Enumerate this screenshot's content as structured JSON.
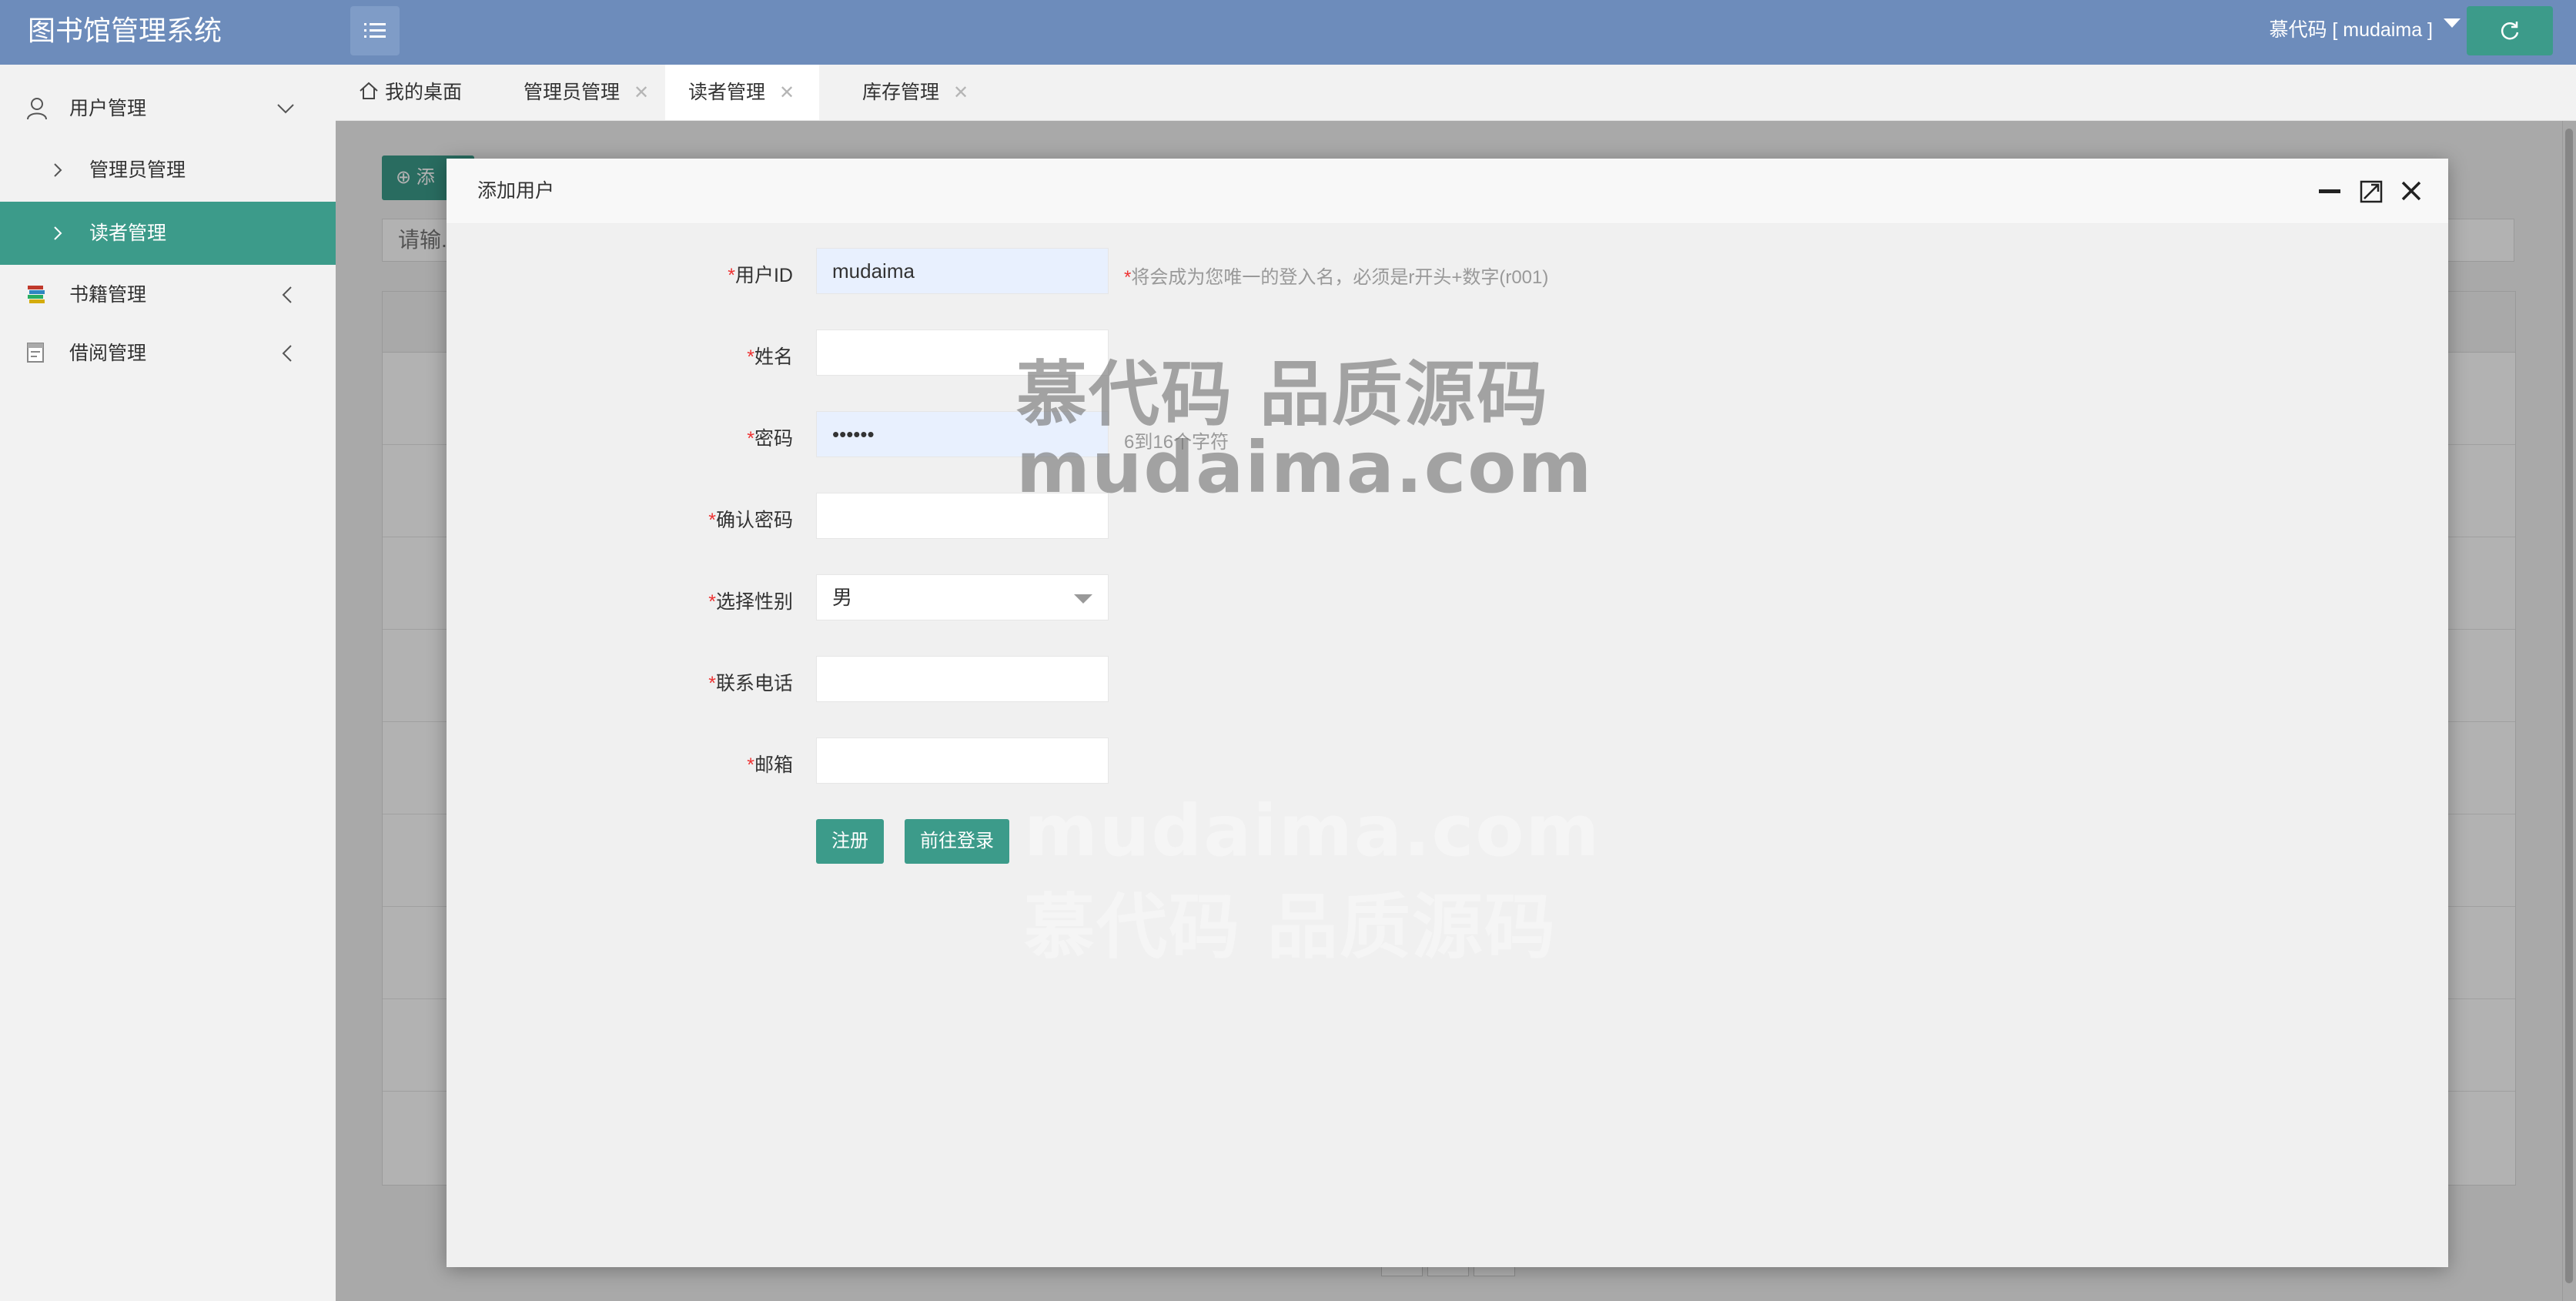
{
  "app": {
    "title": "图书馆管理系统"
  },
  "header": {
    "user_label": "慕代码 [ mudaima ]"
  },
  "sidebar": {
    "items": [
      {
        "label": "用户管理"
      },
      {
        "label": "管理员管理"
      },
      {
        "label": "读者管理"
      },
      {
        "label": "书籍管理"
      },
      {
        "label": "借阅管理"
      }
    ]
  },
  "tabs": [
    {
      "label": "我的桌面"
    },
    {
      "label": "管理员管理"
    },
    {
      "label": "读者管理"
    },
    {
      "label": "库存管理"
    }
  ],
  "background": {
    "add_button": "添",
    "search_placeholder": "请输..."
  },
  "modal": {
    "title": "添加用户",
    "fields": {
      "user_id": {
        "label": "用户ID",
        "value": "mudaima",
        "hint": "将会成为您唯一的登入名，必须是r开头+数字(r001)"
      },
      "name": {
        "label": "姓名",
        "value": ""
      },
      "password": {
        "label": "密码",
        "value": "••••••",
        "hint": "6到16个字符"
      },
      "confirm_password": {
        "label": "确认密码",
        "value": ""
      },
      "gender": {
        "label": "选择性别",
        "value": "男"
      },
      "phone": {
        "label": "联系电话",
        "value": ""
      },
      "email": {
        "label": "邮箱",
        "value": ""
      }
    },
    "register_button": "注册",
    "login_button": "前往登录"
  },
  "watermark": {
    "line1": "慕代码 品质源码",
    "line2": "mudaima.com"
  },
  "colors": {
    "header": "#6d8cbb",
    "accent": "#3c9b8a",
    "required": "#e33333"
  }
}
